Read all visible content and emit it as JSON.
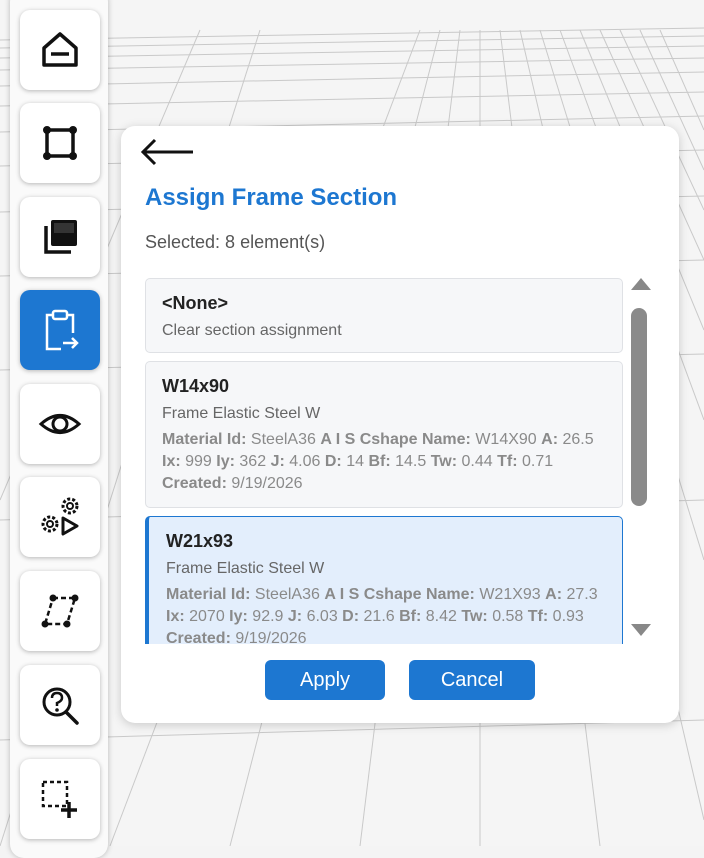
{
  "toolbar": {
    "tools": [
      {
        "icon": "home-icon"
      },
      {
        "icon": "frame-select-icon"
      },
      {
        "icon": "layers-icon"
      },
      {
        "icon": "clipboard-assign-icon",
        "active": true
      },
      {
        "icon": "eye-icon"
      },
      {
        "icon": "gears-run-icon"
      },
      {
        "icon": "skew-shape-icon"
      },
      {
        "icon": "search-help-icon"
      },
      {
        "icon": "add-selection-icon"
      }
    ]
  },
  "panel": {
    "title": "Assign Frame Section",
    "selected_text": "Selected: 8 element(s)",
    "back_icon": "arrow-left-icon",
    "sections": [
      {
        "title": "<None>",
        "subtitle": "Clear section assignment"
      },
      {
        "title": "W14x90",
        "subtitle": "Frame Elastic Steel W",
        "material_label": "Material Id:",
        "material_value": "SteelA36",
        "shape_label": "A I S Cshape Name:",
        "shape_value": "W14X90",
        "a_label": "A:",
        "a_value": "26.5",
        "ix_label": "Ix:",
        "ix_value": "999",
        "iy_label": "Iy:",
        "iy_value": "362",
        "j_label": "J:",
        "j_value": "4.06",
        "d_label": "D:",
        "d_value": "14",
        "bf_label": "Bf:",
        "bf_value": "14.5",
        "tw_label": "Tw:",
        "tw_value": "0.44",
        "tf_label": "Tf:",
        "tf_value": "0.71",
        "created_label": "Created:",
        "created_value": "9/19/2026"
      },
      {
        "title": "W21x93",
        "subtitle": "Frame Elastic Steel W",
        "selected": true,
        "material_label": "Material Id:",
        "material_value": "SteelA36",
        "shape_label": "A I S Cshape Name:",
        "shape_value": "W21X93",
        "a_label": "A:",
        "a_value": "27.3",
        "ix_label": "Ix:",
        "ix_value": "2070",
        "iy_label": "Iy:",
        "iy_value": "92.9",
        "j_label": "J:",
        "j_value": "6.03",
        "d_label": "D:",
        "d_value": "21.6",
        "bf_label": "Bf:",
        "bf_value": "8.42",
        "tw_label": "Tw:",
        "tw_value": "0.58",
        "tf_label": "Tf:",
        "tf_value": "0.93",
        "created_label": "Created:",
        "created_value": "9/19/2026"
      }
    ],
    "apply_label": "Apply",
    "cancel_label": "Cancel"
  },
  "colors": {
    "accent": "#1d77d1",
    "selected_card_bg": "#e3eefc",
    "card_bg": "#f6f7f9"
  }
}
